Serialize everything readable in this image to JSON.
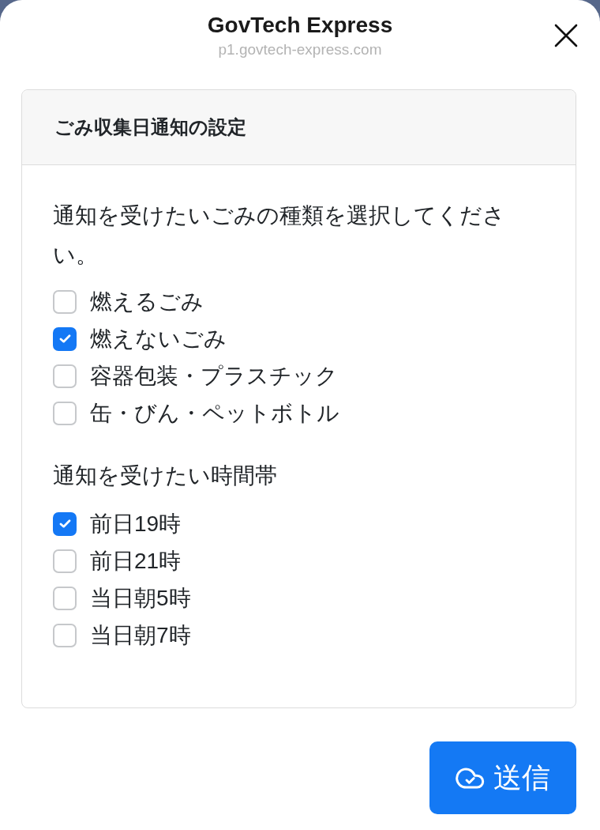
{
  "window": {
    "title": "GovTech Express",
    "url": "p1.govtech-express.com"
  },
  "card": {
    "title": "ごみ収集日通知の設定",
    "groups": [
      {
        "label": "通知を受けたいごみの種類を選択してください。",
        "options": [
          {
            "label": "燃えるごみ",
            "checked": false
          },
          {
            "label": "燃えないごみ",
            "checked": true
          },
          {
            "label": "容器包装・プラスチック",
            "checked": false
          },
          {
            "label": "缶・びん・ペットボトル",
            "checked": false
          }
        ]
      },
      {
        "label": "通知を受けたい時間帯",
        "options": [
          {
            "label": "前日19時",
            "checked": true
          },
          {
            "label": "前日21時",
            "checked": false
          },
          {
            "label": "当日朝5時",
            "checked": false
          },
          {
            "label": "当日朝7時",
            "checked": false
          }
        ]
      }
    ]
  },
  "submit_button": {
    "label": "送信"
  }
}
